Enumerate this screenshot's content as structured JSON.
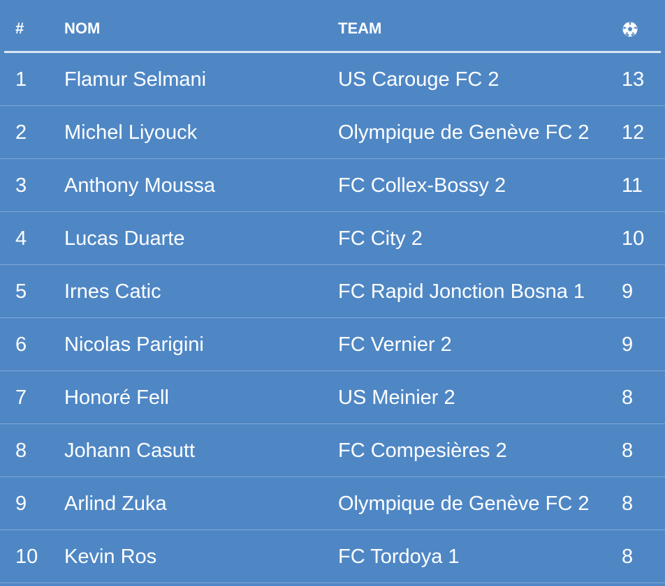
{
  "header": {
    "rank_label": "#",
    "name_label": "NOM",
    "team_label": "TEAM",
    "goals_icon": "soccer-ball-icon"
  },
  "rows": [
    {
      "rank": "1",
      "name": "Flamur Selmani",
      "team": "US Carouge FC 2",
      "goals": "13"
    },
    {
      "rank": "2",
      "name": "Michel Liyouck",
      "team": "Olympique de Genève FC 2",
      "goals": "12"
    },
    {
      "rank": "3",
      "name": "Anthony Moussa",
      "team": "FC Collex-Bossy 2",
      "goals": "11"
    },
    {
      "rank": "4",
      "name": "Lucas Duarte",
      "team": "FC City 2",
      "goals": "10"
    },
    {
      "rank": "5",
      "name": "Irnes Catic",
      "team": "FC Rapid Jonction Bosna 1",
      "goals": "9"
    },
    {
      "rank": "6",
      "name": "Nicolas Parigini",
      "team": "FC Vernier 2",
      "goals": "9"
    },
    {
      "rank": "7",
      "name": "Honoré Fell",
      "team": "US Meinier 2",
      "goals": "8"
    },
    {
      "rank": "8",
      "name": "Johann Casutt",
      "team": "FC Compesières 2",
      "goals": "8"
    },
    {
      "rank": "9",
      "name": "Arlind Zuka",
      "team": "Olympique de Genève FC 2",
      "goals": "8"
    },
    {
      "rank": "10",
      "name": "Kevin Ros",
      "team": "FC Tordoya 1",
      "goals": "8"
    }
  ],
  "colors": {
    "background": "#4f87c5",
    "text": "#ffffff",
    "header_rule": "#d9e6f3"
  }
}
